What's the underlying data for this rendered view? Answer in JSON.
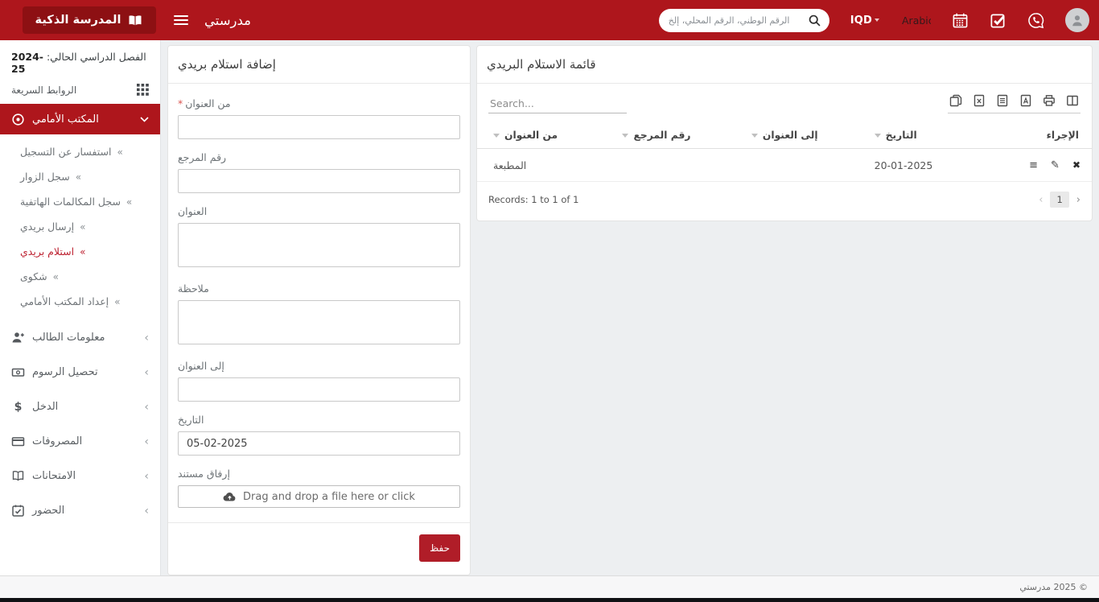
{
  "header": {
    "brand": "المدرسة الذكية",
    "app_title": "مدرستي",
    "search_placeholder": "الرقم الوطني، الرقم المحلي، إلخ",
    "currency": "IQD",
    "language": "Arabic"
  },
  "sidebar": {
    "semester_label": "الفصل الدراسي الحالي:",
    "semester_value": "2024-25",
    "quick_links_label": "الروابط السريعة",
    "active_parent": {
      "label": "المكتب الأمامي"
    },
    "sub_items": [
      {
        "label": "استفسار عن التسجيل"
      },
      {
        "label": "سجل الزوار"
      },
      {
        "label": "سجل المكالمات الهاتفية"
      },
      {
        "label": "إرسال بريدي"
      },
      {
        "label": "استلام بريدي",
        "active": true
      },
      {
        "label": "شكوى"
      },
      {
        "label": "إعداد المكتب الأمامي"
      }
    ],
    "main_items": [
      {
        "label": "معلومات الطالب",
        "icon": "person-plus-icon"
      },
      {
        "label": "تحصيل الرسوم",
        "icon": "banknote-icon"
      },
      {
        "label": "الدخل",
        "icon": "dollar-icon"
      },
      {
        "label": "المصروفات",
        "icon": "credit-card-icon"
      },
      {
        "label": "الامتحانات",
        "icon": "open-book-icon"
      },
      {
        "label": "الحضور",
        "icon": "calendar-check-icon"
      }
    ]
  },
  "form": {
    "title": "إضافة استلام بريدي",
    "fields": {
      "from_title": {
        "label": "من العنوان",
        "required": "*"
      },
      "reference_no": {
        "label": "رقم المرجع"
      },
      "title": {
        "label": "العنوان"
      },
      "note": {
        "label": "ملاحظة"
      },
      "to_title": {
        "label": "إلى العنوان"
      },
      "date": {
        "label": "التاريخ",
        "value": "05-02-2025"
      },
      "attachment": {
        "label": "إرفاق مستند",
        "dropzone_text": "Drag and drop a file here or click"
      }
    },
    "save_label": "حفظ"
  },
  "table": {
    "title": "قائمة الاستلام البريدي",
    "search_placeholder": "Search...",
    "columns": [
      "من العنوان",
      "رقم المرجع",
      "إلى العنوان",
      "التاريخ",
      "الإجراء"
    ],
    "rows": [
      {
        "from_title": "المطبعة",
        "reference_no": "",
        "to_title": "",
        "date": "20-01-2025"
      }
    ],
    "records_text": "Records: 1 to 1 of 1",
    "page": "1",
    "export_icons": [
      "copy-icon",
      "excel-file-icon",
      "text-file-icon",
      "pdf-file-icon",
      "printer-icon",
      "columns-icon"
    ]
  },
  "footer": {
    "copyright": "© 2025 مدرستي"
  },
  "glyphs": {
    "double_chevron_left": "«",
    "chevron_left": "‹",
    "chevron_right": "›",
    "list_icon": "≡",
    "pencil_icon": "✎",
    "delete_icon": "✖",
    "dollar": "$"
  },
  "colors": {
    "header_red": "#ae161c",
    "brand_dark_red": "#8d1013",
    "active_link_red": "#bd2130",
    "save_button_red": "#b01d28"
  }
}
